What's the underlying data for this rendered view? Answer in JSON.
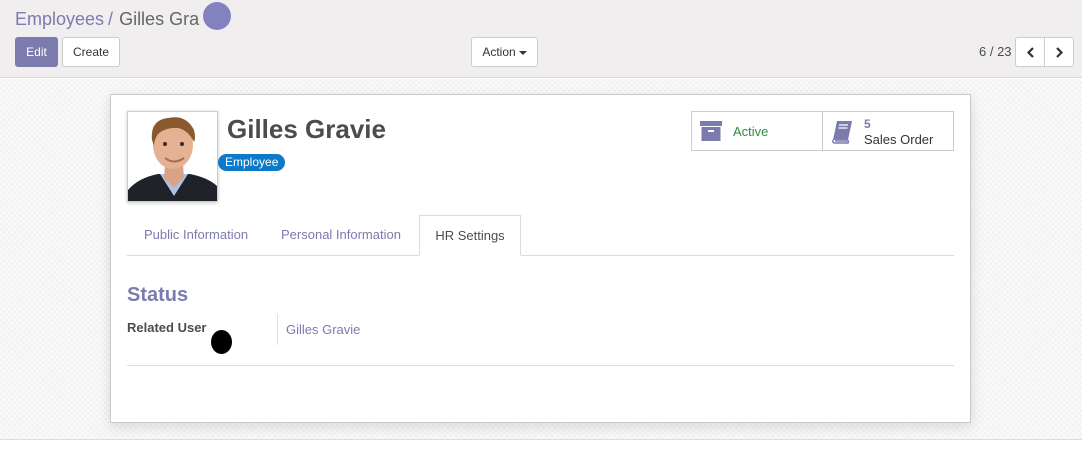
{
  "breadcrumb": {
    "parent": "Employees",
    "separator": "/",
    "current": "Gilles Gra"
  },
  "toolbar": {
    "edit_label": "Edit",
    "create_label": "Create",
    "action_label": "Action"
  },
  "pager": {
    "value": "6 / 23"
  },
  "employee": {
    "name": "Gilles Gravie",
    "tag": "Employee"
  },
  "smart_buttons": {
    "active": {
      "label": "Active"
    },
    "sales": {
      "count": "5",
      "label": "Sales Order"
    }
  },
  "tabs": [
    {
      "label": "Public Information",
      "active": false
    },
    {
      "label": "Personal Information",
      "active": false
    },
    {
      "label": "HR Settings",
      "active": true
    }
  ],
  "hr_settings": {
    "section_title": "Status",
    "fields": [
      {
        "label": "Related User",
        "value": "Gilles Gravie"
      }
    ]
  },
  "colors": {
    "primary": "#7c7bad",
    "tag": "#0b7ac8",
    "active_green": "#2e8b46"
  },
  "icons": {
    "active": "archive-box-icon",
    "sales": "book-icon",
    "prev": "chevron-left-icon",
    "next": "chevron-right-icon"
  }
}
